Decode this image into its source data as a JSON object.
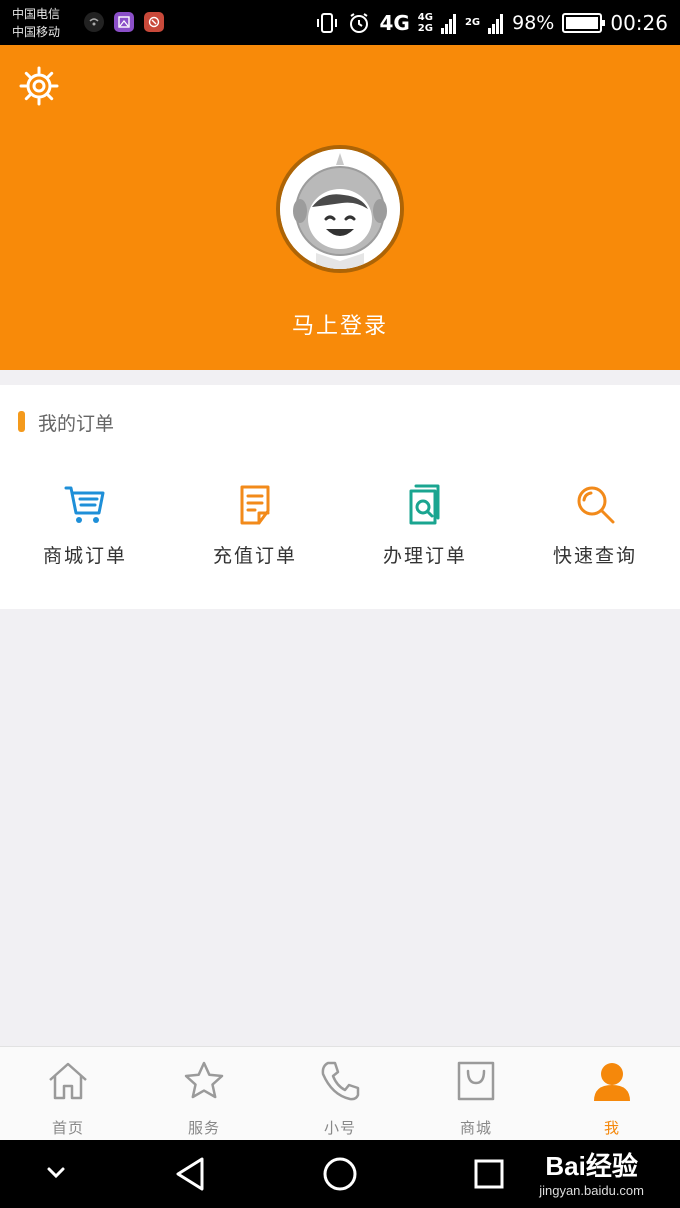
{
  "status_bar": {
    "carrier_1": "中国电信",
    "carrier_2": "中国移动",
    "network_main": "4G",
    "network_sub_top": "4G",
    "network_sub_bottom": "2G",
    "network_third": "2G",
    "battery_percent": "98%",
    "battery_level": 0.98,
    "time": "00:26"
  },
  "header": {
    "settings_icon": "gear-icon",
    "avatar_icon": "cartoon-avatar",
    "login_label": "马上登录",
    "background_color": "#f88a09"
  },
  "orders": {
    "section_title": "我的订单",
    "items": [
      {
        "label": "商城订单",
        "icon": "shopping-cart-icon",
        "color": "#1e8fd8"
      },
      {
        "label": "充值订单",
        "icon": "recharge-document-icon",
        "color": "#f28a1a"
      },
      {
        "label": "办理订单",
        "icon": "handle-document-icon",
        "color": "#1aa590"
      },
      {
        "label": "快速查询",
        "icon": "search-icon",
        "color": "#f28a1a"
      }
    ]
  },
  "bottom_nav": {
    "items": [
      {
        "label": "首页",
        "icon": "home-icon"
      },
      {
        "label": "服务",
        "icon": "star-icon"
      },
      {
        "label": "小号",
        "icon": "phone-icon"
      },
      {
        "label": "商城",
        "icon": "shopping-bag-icon"
      },
      {
        "label": "我",
        "icon": "user-icon",
        "active": true
      }
    ],
    "active_color": "#f5880b",
    "inactive_color": "#888888"
  },
  "watermark": {
    "brand": "Bai经验",
    "url": "jingyan.baidu.com"
  }
}
